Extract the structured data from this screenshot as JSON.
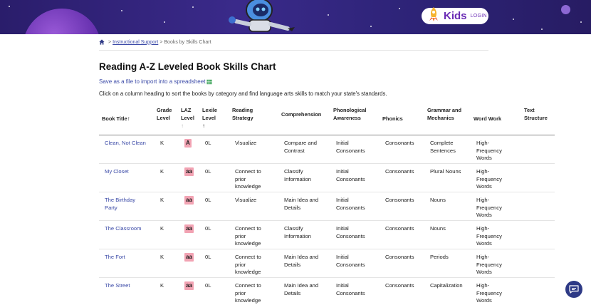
{
  "banner": {
    "kids_label": "Kids",
    "login_label": "LOGIN"
  },
  "breadcrumb": {
    "link": "Instructional Support",
    "separator": ">",
    "current": "Books by Skills Chart"
  },
  "page": {
    "title": "Reading A-Z Leveled Book Skills Chart",
    "save_link": "Save as a file to import into a spreadsheet",
    "instructions": "Click on a column heading to sort the books by category and find language arts skills to match your state's standards."
  },
  "columns": {
    "book_title": "Book Title",
    "book_title_arrow": "↑",
    "grade_1": "Grade",
    "grade_2": "Level",
    "laz_1": "LAZ",
    "laz_2": "Level",
    "laz_arrow": "↑",
    "lexile_1": "Lexile",
    "lexile_2": "Level",
    "lexile_arrow": "↑",
    "strategy_1": "Reading",
    "strategy_2": "Strategy",
    "comprehension": "Comprehension",
    "phono_1": "Phonological",
    "phono_2": "Awareness",
    "phonics": "Phonics",
    "grammar_1": "Grammar and",
    "grammar_2": "Mechanics",
    "word_work": "Word Work",
    "text_1": "Text",
    "text_2": "Structure"
  },
  "rows": [
    {
      "title_1": "Clean, Not Clean",
      "title_2": "",
      "grade": "K",
      "laz": "A",
      "lexile": "0L",
      "strategy_1": "Visualize",
      "strategy_2": "",
      "strategy_3": "",
      "comp_1": "Compare and",
      "comp_2": "Contrast",
      "phono_1": "Initial",
      "phono_2": "Consonants",
      "phonics": "Consonants",
      "grammar_1": "Complete",
      "grammar_2": "Sentences",
      "word_1": "High-",
      "word_2": "Frequency",
      "word_3": "Words",
      "text": ""
    },
    {
      "title_1": "My Closet",
      "title_2": "",
      "grade": "K",
      "laz": "aa",
      "lexile": "0L",
      "strategy_1": "Connect to",
      "strategy_2": "prior",
      "strategy_3": "knowledge",
      "comp_1": "Classify",
      "comp_2": "Information",
      "phono_1": "Initial",
      "phono_2": "Consonants",
      "phonics": "Consonants",
      "grammar_1": "Plural Nouns",
      "grammar_2": "",
      "word_1": "High-",
      "word_2": "Frequency",
      "word_3": "Words",
      "text": ""
    },
    {
      "title_1": "The Birthday",
      "title_2": "Party",
      "grade": "K",
      "laz": "aa",
      "lexile": "0L",
      "strategy_1": "Visualize",
      "strategy_2": "",
      "strategy_3": "",
      "comp_1": "Main Idea and",
      "comp_2": "Details",
      "phono_1": "Initial",
      "phono_2": "Consonants",
      "phonics": "Consonants",
      "grammar_1": "Nouns",
      "grammar_2": "",
      "word_1": "High-",
      "word_2": "Frequency",
      "word_3": "Words",
      "text": ""
    },
    {
      "title_1": "The Classroom",
      "title_2": "",
      "grade": "K",
      "laz": "aa",
      "lexile": "0L",
      "strategy_1": "Connect to",
      "strategy_2": "prior",
      "strategy_3": "knowledge",
      "comp_1": "Classify",
      "comp_2": "Information",
      "phono_1": "Initial",
      "phono_2": "Consonants",
      "phonics": "Consonants",
      "grammar_1": "Nouns",
      "grammar_2": "",
      "word_1": "High-",
      "word_2": "Frequency",
      "word_3": "Words",
      "text": ""
    },
    {
      "title_1": "The Fort",
      "title_2": "",
      "grade": "K",
      "laz": "aa",
      "lexile": "0L",
      "strategy_1": "Connect to",
      "strategy_2": "prior",
      "strategy_3": "knowledge",
      "comp_1": "Main Idea and",
      "comp_2": "Details",
      "phono_1": "Initial",
      "phono_2": "Consonants",
      "phonics": "Consonants",
      "grammar_1": "Periods",
      "grammar_2": "",
      "word_1": "High-",
      "word_2": "Frequency",
      "word_3": "Words",
      "text": ""
    },
    {
      "title_1": "The Street",
      "title_2": "",
      "grade": "K",
      "laz": "aa",
      "lexile": "0L",
      "strategy_1": "Connect to",
      "strategy_2": "prior",
      "strategy_3": "knowledge",
      "comp_1": "Main Idea and",
      "comp_2": "Details",
      "phono_1": "Initial",
      "phono_2": "Consonants",
      "phonics": "Consonants",
      "grammar_1": "Capitalization",
      "grammar_2": "",
      "word_1": "High-",
      "word_2": "Frequency",
      "word_3": "Words",
      "text": ""
    }
  ],
  "icons": {
    "home": "home-icon",
    "spreadsheet": "spreadsheet-icon",
    "rocket": "rocket-icon",
    "chat": "chat-icon"
  },
  "colors": {
    "banner": "#2d2377",
    "link": "#3b4aa7",
    "badge": "#f2a3b3",
    "brand": "#6a2bb5"
  }
}
